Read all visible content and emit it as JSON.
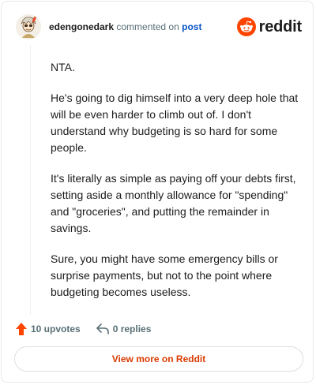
{
  "header": {
    "username": "edengonedark",
    "verb": "commented on",
    "post_link": "post",
    "brand": "reddit"
  },
  "comment": {
    "paragraphs": [
      "NTA.",
      "He's going to dig himself into a very deep hole that will be even harder to climb out of. I don't understand why budgeting is so hard for some people.",
      "It's literally as simple as paying off your debts first, setting aside a monthly allowance for \"spending\" and \"groceries\", and putting the remainder in savings.",
      "Sure, you might have some emergency bills or surprise payments, but not to the point where budgeting becomes useless."
    ]
  },
  "actions": {
    "upvotes": "10 upvotes",
    "replies": "0 replies"
  },
  "footer": {
    "view_more": "View more on Reddit"
  },
  "colors": {
    "brand_orange": "#ff4500",
    "link_blue": "#0b55c8",
    "button_text": "#d93a00"
  },
  "icons": [
    "avatar",
    "reddit-logo-icon",
    "upvote-arrow-icon",
    "reply-arrow-icon"
  ]
}
